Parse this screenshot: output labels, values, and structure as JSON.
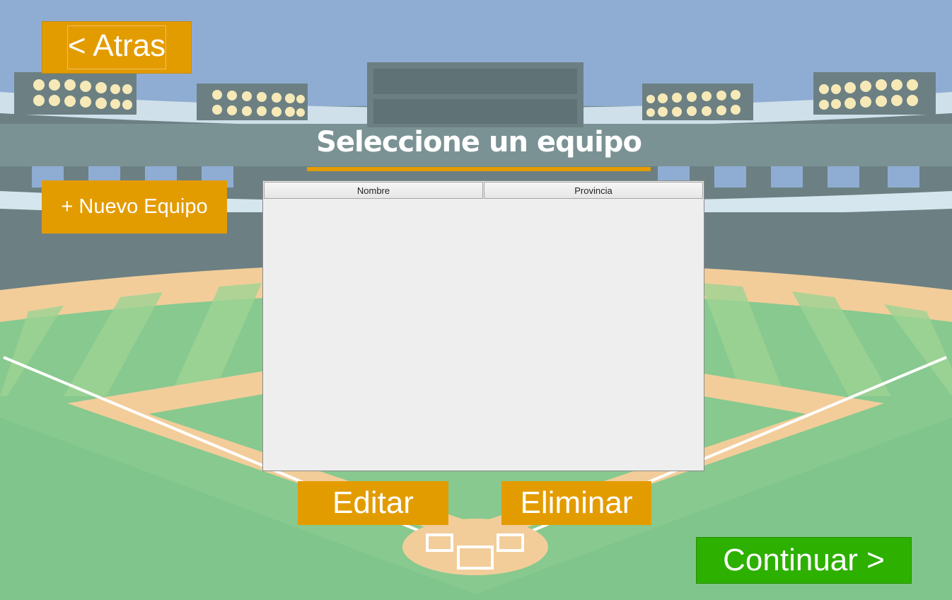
{
  "header": {
    "back_label": "< Atras",
    "title": "Seleccione un equipo"
  },
  "actions": {
    "new_team_label": "+ Nuevo Equipo",
    "edit_label": "Editar",
    "delete_label": "Eliminar",
    "continue_label": "Continuar >"
  },
  "table": {
    "columns": [
      "Nombre",
      "Provincia"
    ],
    "rows": []
  },
  "colors": {
    "accent": "#e39c00",
    "continue": "#2db000",
    "sky": "#8fadd3",
    "grass": "#87c98e",
    "infield": "#f2cd9a"
  }
}
